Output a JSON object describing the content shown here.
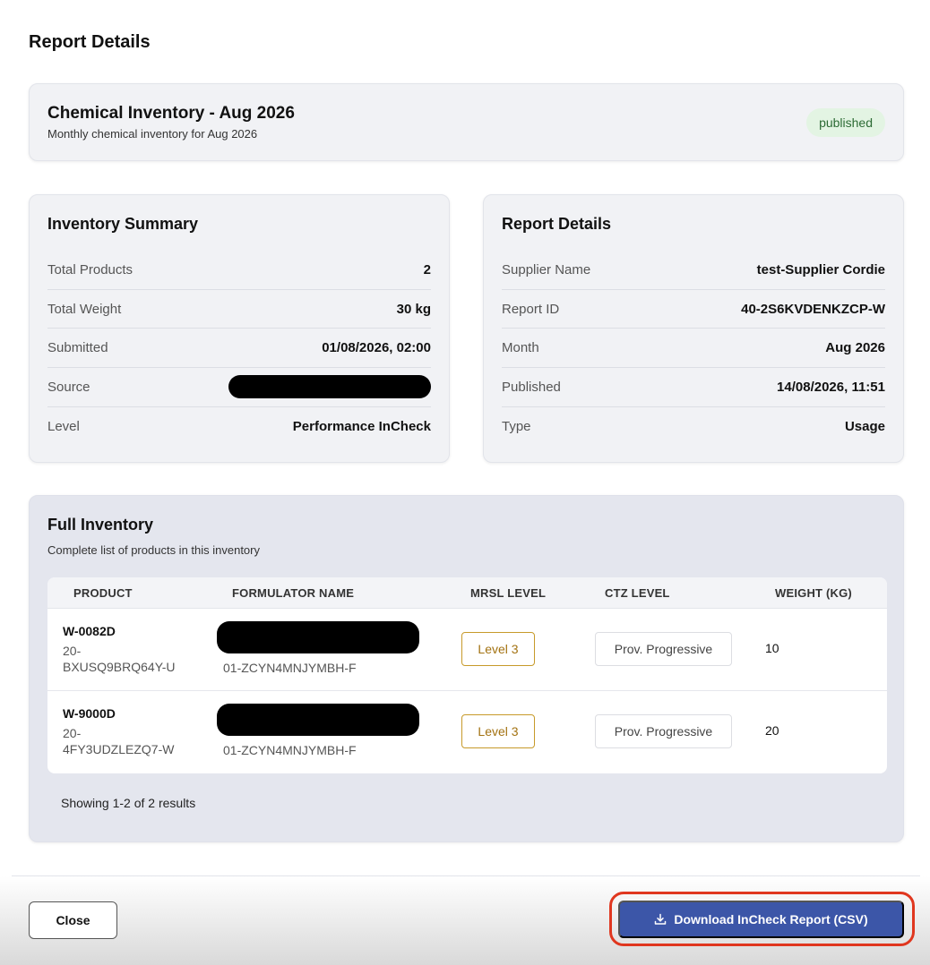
{
  "page": {
    "title": "Report Details"
  },
  "header": {
    "title": "Chemical Inventory - Aug 2026",
    "subtitle": "Monthly chemical inventory for Aug 2026",
    "status": "published"
  },
  "summary": {
    "title": "Inventory Summary",
    "rows": [
      {
        "label": "Total Products",
        "value": "2"
      },
      {
        "label": "Total Weight",
        "value": "30 kg"
      },
      {
        "label": "Submitted",
        "value": "01/08/2026, 02:00"
      },
      {
        "label": "Source",
        "value": ""
      },
      {
        "label": "Level",
        "value": "Performance InCheck"
      }
    ]
  },
  "details": {
    "title": "Report Details",
    "rows": [
      {
        "label": "Supplier Name",
        "value": "test-Supplier Cordie"
      },
      {
        "label": "Report ID",
        "value": "40-2S6KVDENKZCP-W"
      },
      {
        "label": "Month",
        "value": "Aug 2026"
      },
      {
        "label": "Published",
        "value": "14/08/2026, 11:51"
      },
      {
        "label": "Type",
        "value": "Usage"
      }
    ]
  },
  "inventory": {
    "title": "Full Inventory",
    "subtitle": "Complete list of products in this inventory",
    "columns": [
      "PRODUCT",
      "FORMULATOR NAME",
      "MRSL LEVEL",
      "CTZ LEVEL",
      "WEIGHT (KG)"
    ],
    "rows": [
      {
        "product_code": "W-0082D",
        "product_id": "20-\nBXUSQ9BRQ64Y-U",
        "formulator_id": "01-ZCYN4MNJYMBH-F",
        "mrsl": "Level 3",
        "ctz": "Prov. Progressive",
        "weight": "10"
      },
      {
        "product_code": "W-9000D",
        "product_id": "20-\n4FY3UDZLEZQ7-W",
        "formulator_id": "01-ZCYN4MNJYMBH-F",
        "mrsl": "Level 3",
        "ctz": "Prov. Progressive",
        "weight": "20"
      }
    ],
    "showing": "Showing 1-2 of 2 results"
  },
  "footer": {
    "close_label": "Close",
    "download_label": "Download InCheck Report (CSV)",
    "download_icon": "download-icon",
    "highlight_color": "#e0371f",
    "primary_color": "#3c56a8"
  }
}
